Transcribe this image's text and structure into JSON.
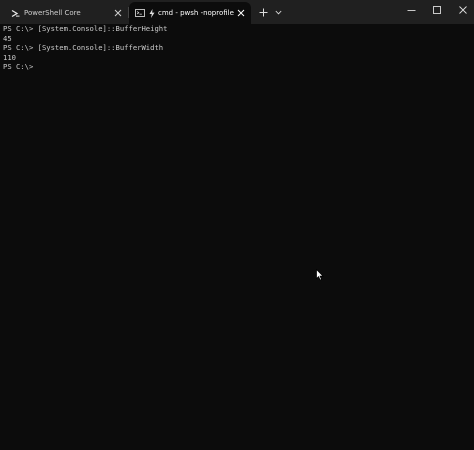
{
  "window": {
    "tabs": [
      {
        "label": "PowerShell Core",
        "active": false,
        "icon": "powershell-icon"
      },
      {
        "label": "cmd - pwsh  -noprofile",
        "active": true,
        "icon": "cmd-icon"
      }
    ],
    "controls": [
      "new-tab",
      "dropdown",
      "minimize",
      "maximize",
      "close"
    ]
  },
  "console": {
    "lines": [
      "PS C:\\> [System.Console]::BufferHeight",
      "45",
      "PS C:\\> [System.Console]::BufferWidth",
      "110",
      "PS C:\\>"
    ]
  },
  "colors": {
    "titlebar": "#202020",
    "console_bg": "#0c0c0c",
    "console_fg": "#cccccc"
  }
}
